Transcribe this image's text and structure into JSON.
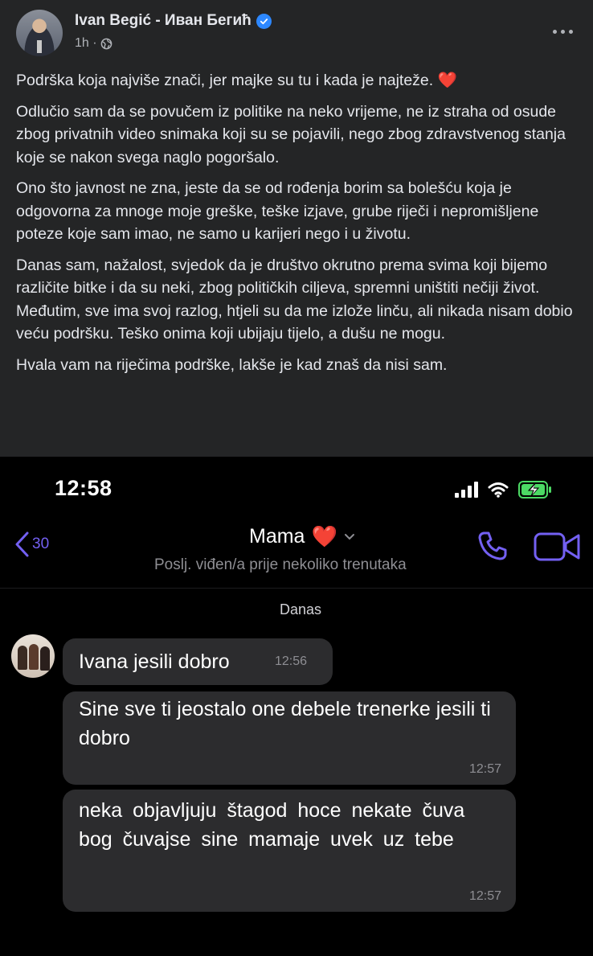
{
  "post": {
    "author": "Ivan Begić - Иван Бегић",
    "time": "1h ·",
    "paragraphs": [
      "Podrška koja najviše znači, jer majke su tu i kada je najteže.",
      "Odlučio sam da se povučem iz politike na neko vrijeme, ne iz straha od osude zbog privatnih video snimaka koji su se pojavili, nego zbog zdravstvenog stanja koje se nakon svega naglo pogoršalo.",
      "Ono što javnost ne zna, jeste da se od rođenja borim sa bolešću koja je odgovorna za mnoge moje greške, teške izjave, grube riječi i nepromišljene poteze koje sam imao, ne samo u karijeri nego i u životu.",
      "Danas sam, nažalost, svjedok da je društvo okrutno prema svima koji bijemo različite bitke i da su neki, zbog političkih ciljeva, spremni uništiti nečiji život. Međutim, sve ima svoj razlog, htjeli su da me izlože linču, ali nikada nisam dobio veću podršku. Teško onima koji ubijaju tijelo, a dušu ne mogu.",
      "Hvala vam na riječima podrške, lakše je kad znaš da nisi sam."
    ],
    "heart": "❤️"
  },
  "phone": {
    "status_time": "12:58",
    "back_count": "30",
    "chat_title": "Mama",
    "chat_title_heart": "❤️",
    "chat_subtitle": "Poslj. viđen/a prije nekoliko trenutaka",
    "day_label": "Danas",
    "messages": [
      {
        "text": "Ivana jesili dobro",
        "time": "12:56"
      },
      {
        "text": "Sine sve ti jeostalo one debele trenerke jesili ti dobro",
        "time": "12:57"
      },
      {
        "text": "neka objavljuju štagod hoce nekate čuva bog čuvajse sine mamaje uvek uz tebe",
        "time": "12:57"
      }
    ]
  },
  "colors": {
    "fb_background": "#242526",
    "verified_blue": "#2d88ff",
    "viber_purple": "#7360f2",
    "bubble": "#2c2c2e",
    "battery_green": "#4cd964"
  },
  "icons": [
    "verified-icon",
    "globe-icon",
    "more-icon",
    "signal-icon",
    "wifi-icon",
    "battery-charging-icon",
    "back-chevron-icon",
    "chevron-down-icon",
    "phone-icon",
    "video-icon"
  ]
}
